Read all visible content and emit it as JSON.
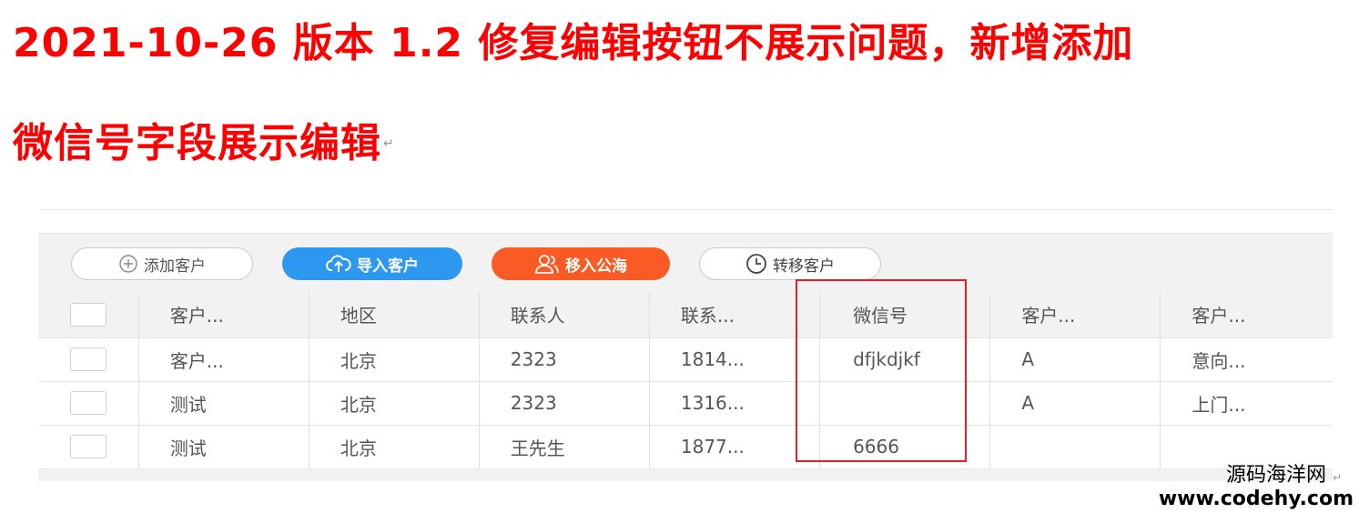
{
  "doc": {
    "line1": "2021-10-26 版本 1.2 修复编辑按钮不展示问题，新增添加",
    "line2": "微信号字段展示编辑",
    "para_mark": "↵"
  },
  "toolbar": {
    "add_label": "添加客户",
    "import_label": "导入客户",
    "move_label": "移入公海",
    "transfer_label": "转移客户"
  },
  "table": {
    "columns": [
      "客户...",
      "地区",
      "联系人",
      "联系...",
      "微信号",
      "客户...",
      "客户..."
    ],
    "rows": [
      [
        "客户...",
        "北京",
        "2323",
        "1814...",
        "dfjkdjkf",
        "A",
        "意向..."
      ],
      [
        "测试",
        "北京",
        "2323",
        "1316...",
        "",
        "A",
        "上门..."
      ],
      [
        "测试",
        "北京",
        "王先生",
        "1877...",
        "6666",
        "",
        ""
      ]
    ]
  },
  "watermark": {
    "line1": "源码海洋网",
    "line2": "www.codehy.com"
  },
  "colors": {
    "heading": "#ff0000",
    "import_button": "#2c98f0",
    "move_button": "#fa5a24",
    "highlight_box": "#e81e24"
  },
  "icons": {
    "add": "plus-circle-icon",
    "import": "cloud-upload-icon",
    "move": "users-icon",
    "transfer": "clock-icon"
  }
}
